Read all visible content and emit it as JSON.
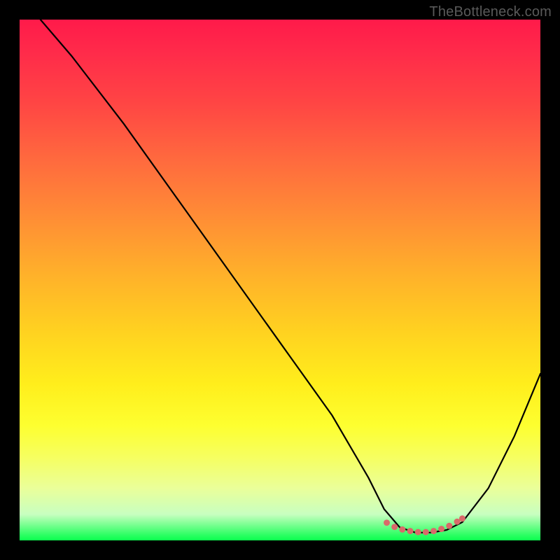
{
  "watermark": "TheBottleneck.com",
  "chart_data": {
    "type": "line",
    "title": "",
    "xlabel": "",
    "ylabel": "",
    "xlim": [
      0,
      100
    ],
    "ylim": [
      0,
      100
    ],
    "series": [
      {
        "name": "bottleneck-curve",
        "x": [
          4,
          10,
          20,
          30,
          40,
          50,
          60,
          67,
          70,
          73,
          76,
          79,
          82,
          85,
          90,
          95,
          100
        ],
        "values": [
          100,
          93,
          80,
          66,
          52,
          38,
          24,
          12,
          6,
          2.5,
          1.5,
          1.5,
          2,
          3.5,
          10,
          20,
          32
        ]
      },
      {
        "name": "optimal-range-markers",
        "x": [
          70.5,
          72,
          73.5,
          75,
          76.5,
          78,
          79.5,
          81,
          82.5,
          84,
          85
        ],
        "values": [
          3.4,
          2.6,
          2.1,
          1.8,
          1.6,
          1.6,
          1.8,
          2.2,
          2.8,
          3.6,
          4.2
        ]
      }
    ],
    "colors": {
      "curve": "#000000",
      "markers": "#d96a6a",
      "gradient_top": "#ff1a4a",
      "gradient_bottom": "#0bff4e"
    }
  }
}
